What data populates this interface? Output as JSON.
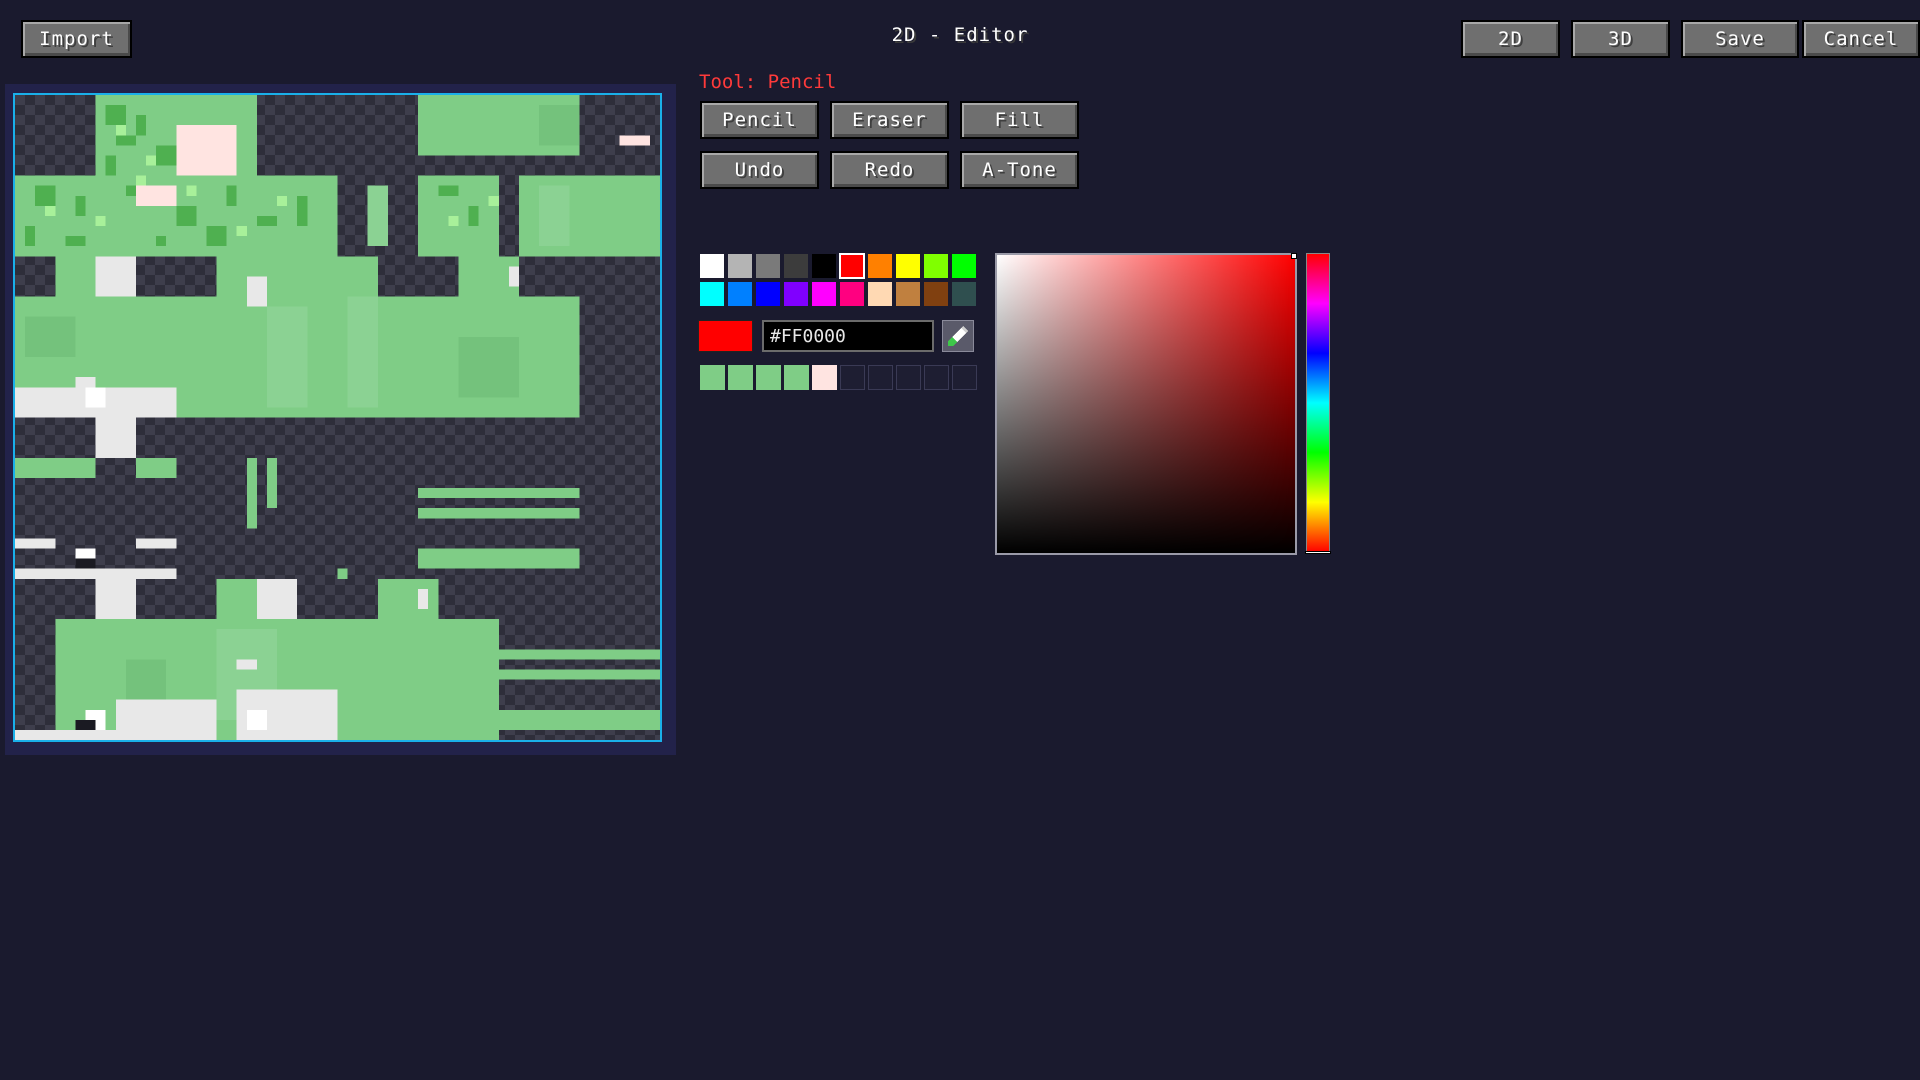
{
  "header": {
    "title": "2D - Editor",
    "import_label": "Import",
    "mode_2d_label": "2D",
    "mode_3d_label": "3D",
    "save_label": "Save",
    "cancel_label": "Cancel"
  },
  "tools": {
    "current_tool_text": "Tool: Pencil",
    "pencil_label": "Pencil",
    "eraser_label": "Eraser",
    "fill_label": "Fill",
    "undo_label": "Undo",
    "redo_label": "Redo",
    "atone_label": "A-Tone"
  },
  "palette": {
    "selected": "#ff0000",
    "colors": [
      "#ffffff",
      "#b4b4b4",
      "#7a7a7a",
      "#3c3c3c",
      "#000000",
      "#ff0000",
      "#ff8000",
      "#ffff00",
      "#80ff00",
      "#00ff00",
      "#00ffff",
      "#0080ff",
      "#0000ff",
      "#8000ff",
      "#ff00ff",
      "#ff0080",
      "#ffd9b3",
      "#c0803f",
      "#804010",
      "#2f4f4f"
    ],
    "recent": [
      "#7fcd86",
      "#7fcd86",
      "#7fcd86",
      "#7fcd86",
      "#ffe4e1",
      null,
      null,
      null,
      null,
      null
    ]
  },
  "color_picker": {
    "current_color": "#ff0000",
    "hex_value": "#FF0000",
    "hue_degrees": 0,
    "saturation": 1,
    "brightness": 1
  },
  "canvas": {
    "frame_color": "#1ab0ea",
    "skin_main_color": "#7fcd86",
    "skin_light_color": "#ffe4e1"
  },
  "icons": {
    "eyedropper": "eyedropper-icon"
  }
}
